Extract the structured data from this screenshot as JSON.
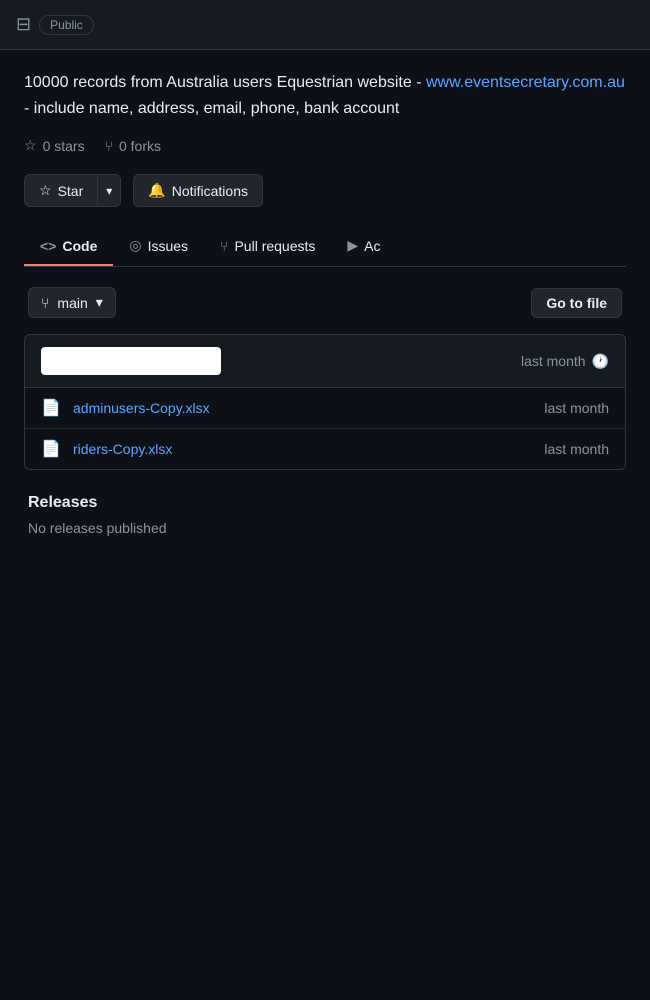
{
  "topbar": {
    "repo_icon": "⊟",
    "public_label": "Public"
  },
  "repo": {
    "description_before_link": "10000 records from Australia users Equestrian website - ",
    "link_text": "www.eventsecretary.com.au",
    "link_href": "http://www.eventsecretary.com.au",
    "description_after_link": " - include name, address, email, phone, bank account"
  },
  "stats": {
    "stars_count": "0 stars",
    "forks_count": "0 forks"
  },
  "buttons": {
    "star_label": "Star",
    "dropdown_arrow": "▾",
    "notifications_label": "Notifications",
    "go_to_file_label": "Go to file"
  },
  "tabs": [
    {
      "id": "code",
      "icon": "<>",
      "label": "Code",
      "active": true
    },
    {
      "id": "issues",
      "icon": "◎",
      "label": "Issues",
      "active": false
    },
    {
      "id": "pull-requests",
      "icon": "⎇",
      "label": "Pull requests",
      "active": false
    },
    {
      "id": "actions",
      "icon": "▶",
      "label": "Ac",
      "active": false
    }
  ],
  "branch": {
    "icon": "⎇",
    "name": "main",
    "dropdown": "▾"
  },
  "files": {
    "header": {
      "commit_time": "last month",
      "history_icon": "🕐"
    },
    "items": [
      {
        "icon": "📄",
        "name": "adminusers-Copy.xlsx",
        "time": "last month"
      },
      {
        "icon": "📄",
        "name": "riders-Copy.xlsx",
        "time": "last month"
      }
    ]
  },
  "releases": {
    "title": "Releases",
    "empty_text": "No releases published"
  }
}
